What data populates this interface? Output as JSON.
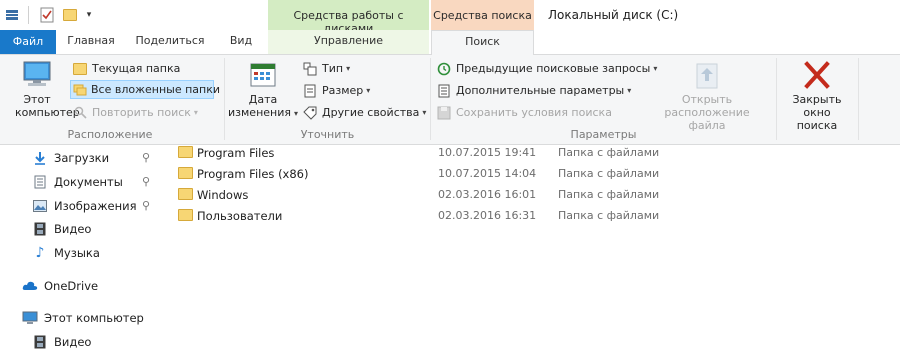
{
  "window": {
    "title": "Локальный диск (C:)",
    "context_tab_groups": [
      "Средства работы с дисками",
      "Средства поиска"
    ]
  },
  "tabs": [
    "Файл",
    "Главная",
    "Поделиться",
    "Вид",
    "Управление",
    "Поиск"
  ],
  "ribbon": {
    "location": {
      "this_pc": "Этот компьютер",
      "current_folder": "Текущая папка",
      "all_subfolders": "Все вложенные папки",
      "repeat_search": "Повторить поиск",
      "group_label": "Расположение"
    },
    "refine": {
      "date_modified": "Дата изменения",
      "type": "Тип",
      "size": "Размер",
      "other_properties": "Другие свойства",
      "group_label": "Уточнить"
    },
    "options": {
      "recent_searches": "Предыдущие поисковые запросы",
      "advanced_options": "Дополнительные параметры",
      "save_search": "Сохранить условия поиска",
      "open_file_location": "Открыть расположение файла",
      "group_label": "Параметры"
    },
    "close": {
      "close_search": "Закрыть окно поиска"
    }
  },
  "nav": {
    "quick_access": [
      {
        "label": "Загрузки",
        "icon": "download-icon",
        "pinned": true
      },
      {
        "label": "Документы",
        "icon": "documents-icon",
        "pinned": true
      },
      {
        "label": "Изображения",
        "icon": "pictures-icon",
        "pinned": true
      },
      {
        "label": "Видео",
        "icon": "video-icon",
        "pinned": false
      },
      {
        "label": "Музыка",
        "icon": "music-icon",
        "pinned": false
      }
    ],
    "onedrive": "OneDrive",
    "this_pc": "Этот компьютер",
    "this_pc_children": [
      {
        "label": "Видео",
        "icon": "video-icon"
      }
    ]
  },
  "files": [
    {
      "name": "Program Files",
      "date": "10.07.2015 19:41",
      "type": "Папка с файлами"
    },
    {
      "name": "Program Files (x86)",
      "date": "10.07.2015 14:04",
      "type": "Папка с файлами"
    },
    {
      "name": "Windows",
      "date": "02.03.2016 16:01",
      "type": "Папка с файлами"
    },
    {
      "name": "Пользователи",
      "date": "02.03.2016 16:31",
      "type": "Папка с файлами"
    }
  ],
  "colors": {
    "file_tab": "#1979ca",
    "context_green": "#d4ecc3",
    "context_orange": "#f9d8c0",
    "close_x": "#c42b1c",
    "selection": "#cce8ff"
  }
}
